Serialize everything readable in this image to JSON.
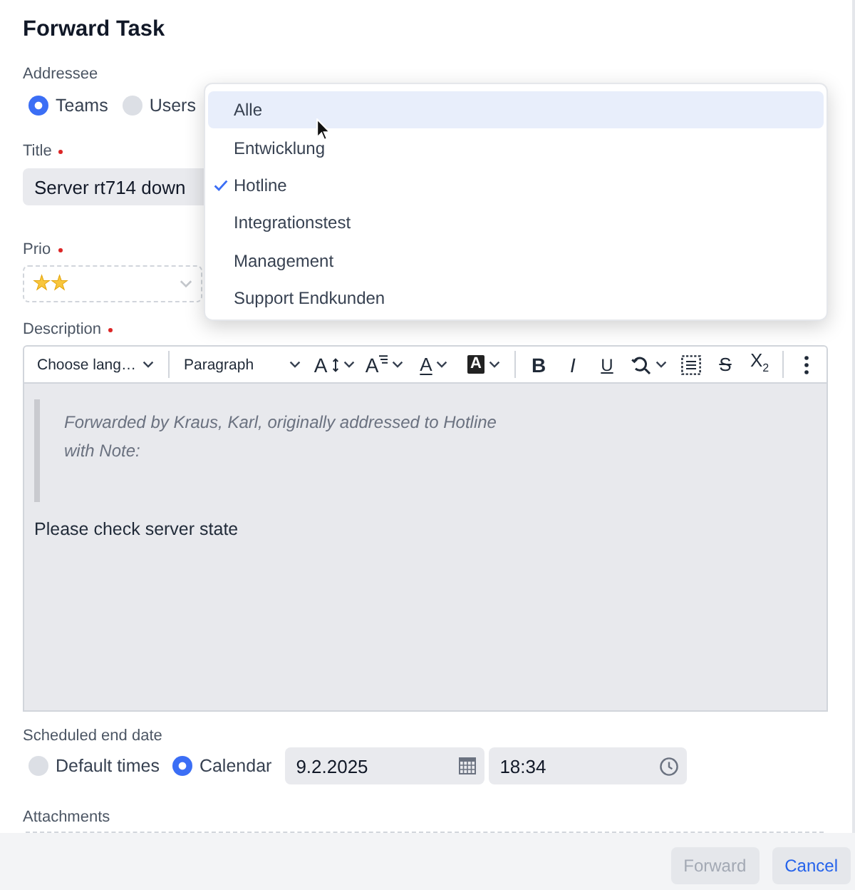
{
  "dialog": {
    "title": "Forward Task"
  },
  "addressee": {
    "label": "Addressee",
    "options": [
      {
        "label": "Teams",
        "selected": true
      },
      {
        "label": "Users",
        "selected": false
      }
    ]
  },
  "team_dropdown": {
    "items": [
      {
        "label": "Alle",
        "hovered": true,
        "selected": false
      },
      {
        "label": "Entwicklung",
        "hovered": false,
        "selected": false
      },
      {
        "label": "Hotline",
        "hovered": false,
        "selected": true
      },
      {
        "label": "Integrationstest",
        "hovered": false,
        "selected": false
      },
      {
        "label": "Management",
        "hovered": false,
        "selected": false
      },
      {
        "label": "Support Endkunden",
        "hovered": false,
        "selected": false
      }
    ]
  },
  "title_field": {
    "label": "Title",
    "required": true,
    "value": "Server rt714 down"
  },
  "prio_field": {
    "label": "Prio",
    "required": true,
    "value": "★★"
  },
  "description": {
    "label": "Description",
    "required": true,
    "toolbar": [
      [
        {
          "kind": "select",
          "label": "Choose lang…"
        }
      ],
      [
        {
          "kind": "select",
          "label": "Paragraph"
        },
        {
          "kind": "font-size",
          "glyph": "A",
          "caret": true
        },
        {
          "kind": "text-style",
          "glyph": "A",
          "caret": true
        },
        {
          "kind": "font-color",
          "glyph": "A",
          "caret": true
        },
        {
          "kind": "highlight",
          "glyph": "A",
          "caret": true
        }
      ],
      [
        {
          "kind": "bold",
          "glyph": "B"
        },
        {
          "kind": "italic",
          "glyph": "I"
        },
        {
          "kind": "underline",
          "glyph": "U"
        },
        {
          "kind": "find",
          "caret": true
        },
        {
          "kind": "select-all"
        },
        {
          "kind": "strikethrough",
          "glyph": "S"
        },
        {
          "kind": "subscript",
          "glyph": "X$_{2}$"
        }
      ],
      [
        {
          "kind": "more"
        }
      ]
    ],
    "quote_lines": [
      "Forwarded by Kraus, Karl, originally addressed to Hotline",
      "with Note:"
    ],
    "body": "Please check server state"
  },
  "scheduled_end_date": {
    "label": "Scheduled end date",
    "options": [
      {
        "label": "Default times",
        "selected": false
      },
      {
        "label": "Calendar",
        "selected": true
      }
    ],
    "date": "9.2.2025",
    "time": "18:34"
  },
  "attachments": {
    "label": "Attachments"
  },
  "buttons": [
    {
      "label": "Forward",
      "disabled": true
    },
    {
      "label": "Cancel",
      "disabled": false
    }
  ]
}
